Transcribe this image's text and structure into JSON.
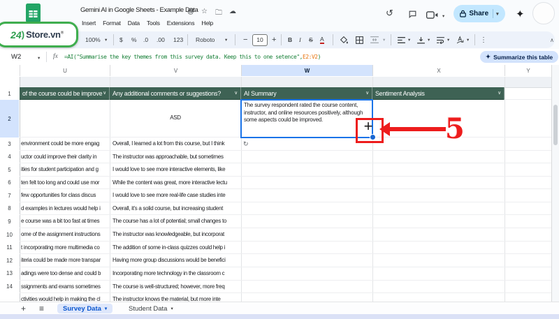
{
  "brand": {
    "prefix": "24",
    "paren": ")",
    "name": "Store.vn",
    "reg": "®"
  },
  "titlebar": {
    "title": "Gemini AI in Google Sheets - Example Data",
    "menus": [
      "Insert",
      "Format",
      "Data",
      "Tools",
      "Extensions",
      "Help"
    ],
    "share": "Share"
  },
  "icons": {
    "caret": "▾",
    "chevron": "∨",
    "history": "↺",
    "sparkle": "✦",
    "more": "⋮",
    "collapse": "∧",
    "refresh": "↻",
    "crosshair": "+",
    "labels": "@",
    "star": "☆",
    "folder": "🗀",
    "cloud": "☁",
    "plus": "+",
    "hamburger": "≡"
  },
  "toolbar": {
    "zoom": "100%",
    "currency": "$",
    "percent": "%",
    "dec_decrease": ".0",
    "dec_increase": ".00",
    "more_formats": "123",
    "font": "Roboto",
    "minus": "−",
    "font_size": "10",
    "plus": "+",
    "bold": "B",
    "italic": "I",
    "strikethrough": "S",
    "text_color": "A"
  },
  "formula": {
    "cell_ref": "W2",
    "fx": "fx",
    "text": "=AI(\"Summarise the key themes from this survey data. Keep this to one setence\",",
    "range": "E2:V2",
    "close": ")",
    "summarize": "Summarize this table"
  },
  "grid": {
    "col_letters": [
      "U",
      "V",
      "W",
      "X",
      "Y"
    ],
    "headers": [
      "of the course could be improve",
      "Any additional comments or suggestions?",
      "AI Summary",
      "Sentiment Analysis"
    ],
    "r1": "1",
    "r2": "2",
    "v2": "ASD",
    "w2": "The survey respondent rated the course content, instructor, and online resources positively, although some aspects could be improved.",
    "rows": [
      {
        "n": "3",
        "u": "environment could be more engag",
        "v": "Overall, I learned a lot from this course, but I think"
      },
      {
        "n": "4",
        "u": "uctor could improve their clarity in",
        "v": "The instructor was approachable, but sometimes"
      },
      {
        "n": "5",
        "u": "ities for student participation and g",
        "v": "I would love to see more interactive elements, like"
      },
      {
        "n": "6",
        "u": "ten felt too long and could use mor",
        "v": "While the content was great, more interactive lectu"
      },
      {
        "n": "7",
        "u": "few opportunities for class discus",
        "v": "I would love to see more real-life case studies inte"
      },
      {
        "n": "8",
        "u": "d examples in lectures would help i",
        "v": "Overall, it's a solid course, but increasing student"
      },
      {
        "n": "9",
        "u": "e course was a bit too fast at times",
        "v": "The course has a lot of potential; small changes to"
      },
      {
        "n": "10",
        "u": "ome of the assignment instructions",
        "v": "The instructor was knowledgeable, but incorporat"
      },
      {
        "n": "11",
        "u": "t incorporating more multimedia co",
        "v": "The addition of some in-class quizzes could help i"
      },
      {
        "n": "12",
        "u": "iteria could be made more transpar",
        "v": "Having more group discussions would be benefici"
      },
      {
        "n": "13",
        "u": "adings were too dense and could b",
        "v": "Incorporating more technology in the classroom c"
      },
      {
        "n": "14",
        "u": "ssignments and exams sometimes",
        "v": "The course is well-structured; however, more freq"
      },
      {
        "n": "",
        "u": "ctivities would help in making the cl",
        "v": "The instructor knows the material, but more inte"
      }
    ]
  },
  "annotation": {
    "step": "5"
  },
  "sheetbar": {
    "tabs": [
      "Survey Data",
      "Student Data"
    ]
  },
  "colors": {
    "header_green": "#3e6254",
    "accent_blue": "#1a73e8",
    "annotation_red": "#ed1c1c",
    "selected_col": "#d3e3fd"
  }
}
